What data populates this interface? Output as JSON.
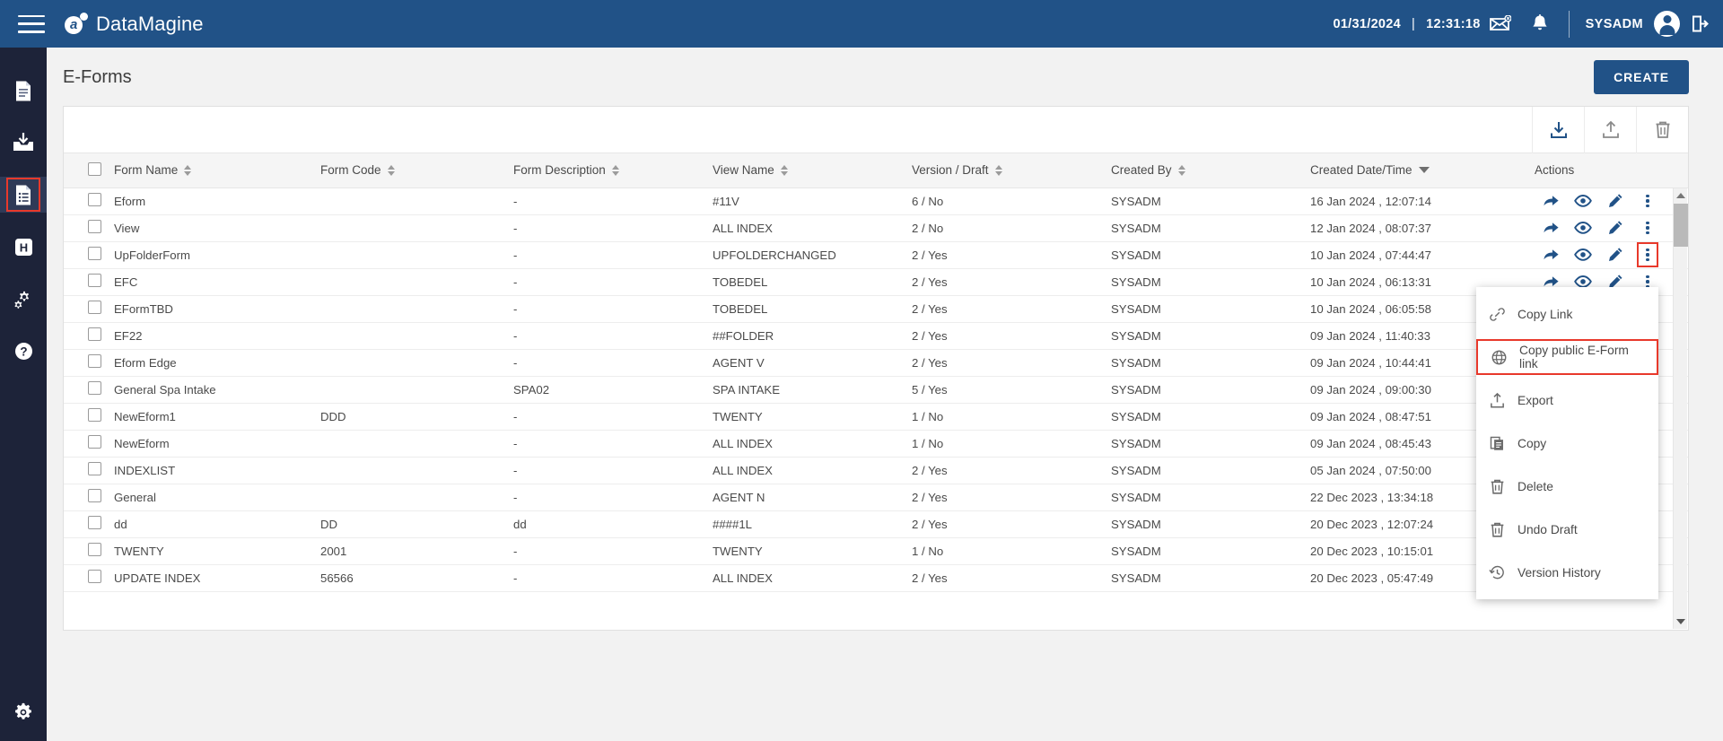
{
  "header": {
    "menu_icon": "hamburger-icon",
    "brand": "DataMagine",
    "date": "01/31/2024",
    "separator": "|",
    "time": "12:31:18",
    "mail_icon": "mail-icon",
    "bell_icon": "bell-icon",
    "username": "SYSADM",
    "avatar_icon": "user-avatar-icon",
    "logout_icon": "logout-icon"
  },
  "sidebar": {
    "items": [
      {
        "name": "document-icon",
        "label": "Documents",
        "active": false
      },
      {
        "name": "inbox-download-icon",
        "label": "Import",
        "active": false
      },
      {
        "name": "eform-document-icon",
        "label": "E-Forms",
        "active": true
      },
      {
        "name": "h-badge-icon",
        "label": "History",
        "active": false
      },
      {
        "name": "gears-icon",
        "label": "Workflow",
        "active": false
      },
      {
        "name": "help-circle-icon",
        "label": "Help",
        "active": false
      }
    ],
    "settings": {
      "name": "settings-gear-icon",
      "label": "Settings"
    }
  },
  "page": {
    "title": "E-Forms",
    "create_button": "CREATE"
  },
  "toolbar": {
    "buttons": [
      {
        "name": "download-icon",
        "label": "Download",
        "color": "#215287"
      },
      {
        "name": "upload-icon",
        "label": "Upload",
        "color": "#8a8a8a"
      },
      {
        "name": "trash-icon",
        "label": "Delete",
        "color": "#8a8a8a"
      }
    ]
  },
  "table": {
    "columns": [
      {
        "key": "checkbox",
        "label": "",
        "sortable": false
      },
      {
        "key": "form_name",
        "label": "Form Name",
        "sortable": true,
        "sorted": "none"
      },
      {
        "key": "form_code",
        "label": "Form Code",
        "sortable": true,
        "sorted": "none"
      },
      {
        "key": "form_description",
        "label": "Form Description",
        "sortable": true,
        "sorted": "none"
      },
      {
        "key": "view_name",
        "label": "View Name",
        "sortable": true,
        "sorted": "none"
      },
      {
        "key": "version_draft",
        "label": "Version / Draft",
        "sortable": true,
        "sorted": "none"
      },
      {
        "key": "created_by",
        "label": "Created By",
        "sortable": true,
        "sorted": "none"
      },
      {
        "key": "created_date_time",
        "label": "Created Date/Time",
        "sortable": true,
        "sorted": "desc"
      },
      {
        "key": "actions",
        "label": "Actions",
        "sortable": false
      }
    ],
    "rows": [
      {
        "form_name": "Eform",
        "form_code": "",
        "form_description": "-",
        "view_name": "#11V",
        "version_draft": "6 / No",
        "created_by": "SYSADM",
        "created_date_time": "16 Jan 2024 , 12:07:14",
        "menu_open": false
      },
      {
        "form_name": "View",
        "form_code": "",
        "form_description": "-",
        "view_name": "ALL INDEX",
        "version_draft": "2 / No",
        "created_by": "SYSADM",
        "created_date_time": "12 Jan 2024 , 08:07:37",
        "menu_open": false
      },
      {
        "form_name": "UpFolderForm",
        "form_code": "",
        "form_description": "-",
        "view_name": "UPFOLDERCHANGED",
        "version_draft": "2 / Yes",
        "created_by": "SYSADM",
        "created_date_time": "10 Jan 2024 , 07:44:47",
        "menu_open": true
      },
      {
        "form_name": "EFC",
        "form_code": "",
        "form_description": "-",
        "view_name": "TOBEDEL",
        "version_draft": "2 / Yes",
        "created_by": "SYSADM",
        "created_date_time": "10 Jan 2024 , 06:13:31",
        "menu_open": false
      },
      {
        "form_name": "EFormTBD",
        "form_code": "",
        "form_description": "-",
        "view_name": "TOBEDEL",
        "version_draft": "2 / Yes",
        "created_by": "SYSADM",
        "created_date_time": "10 Jan 2024 , 06:05:58",
        "menu_open": false
      },
      {
        "form_name": "EF22",
        "form_code": "",
        "form_description": "-",
        "view_name": "##FOLDER",
        "version_draft": "2 / Yes",
        "created_by": "SYSADM",
        "created_date_time": "09 Jan 2024 , 11:40:33",
        "menu_open": false
      },
      {
        "form_name": "Eform Edge",
        "form_code": "",
        "form_description": "-",
        "view_name": "AGENT V",
        "version_draft": "2 / Yes",
        "created_by": "SYSADM",
        "created_date_time": "09 Jan 2024 , 10:44:41",
        "menu_open": false
      },
      {
        "form_name": "General Spa Intake",
        "form_code": "",
        "form_description": "SPA02",
        "view_name": "SPA INTAKE",
        "version_draft": "5 / Yes",
        "created_by": "SYSADM",
        "created_date_time": "09 Jan 2024 , 09:00:30",
        "menu_open": false
      },
      {
        "form_name": "NewEform1",
        "form_code": "DDD",
        "form_description": "-",
        "view_name": "TWENTY",
        "version_draft": "1 / No",
        "created_by": "SYSADM",
        "created_date_time": "09 Jan 2024 , 08:47:51",
        "menu_open": false
      },
      {
        "form_name": "NewEform",
        "form_code": "",
        "form_description": "-",
        "view_name": "ALL INDEX",
        "version_draft": "1 / No",
        "created_by": "SYSADM",
        "created_date_time": "09 Jan 2024 , 08:45:43",
        "menu_open": false
      },
      {
        "form_name": "INDEXLIST",
        "form_code": "",
        "form_description": "-",
        "view_name": "ALL INDEX",
        "version_draft": "2 / Yes",
        "created_by": "SYSADM",
        "created_date_time": "05 Jan 2024 , 07:50:00",
        "menu_open": false
      },
      {
        "form_name": "General",
        "form_code": "",
        "form_description": "-",
        "view_name": "AGENT N",
        "version_draft": "2 / Yes",
        "created_by": "SYSADM",
        "created_date_time": "22 Dec 2023 , 13:34:18",
        "menu_open": false
      },
      {
        "form_name": "dd",
        "form_code": "DD",
        "form_description": "dd",
        "view_name": "####1L",
        "version_draft": "2 / Yes",
        "created_by": "SYSADM",
        "created_date_time": "20 Dec 2023 , 12:07:24",
        "menu_open": false
      },
      {
        "form_name": "TWENTY",
        "form_code": "2001",
        "form_description": "-",
        "view_name": "TWENTY",
        "version_draft": "1 / No",
        "created_by": "SYSADM",
        "created_date_time": "20 Dec 2023 , 10:15:01",
        "menu_open": false
      },
      {
        "form_name": "UPDATE INDEX",
        "form_code": "56566",
        "form_description": "-",
        "view_name": "ALL INDEX",
        "version_draft": "2 / Yes",
        "created_by": "SYSADM",
        "created_date_time": "20 Dec 2023 , 05:47:49",
        "menu_open": false
      }
    ],
    "row_actions": [
      {
        "name": "share-icon",
        "label": "Share"
      },
      {
        "name": "eye-icon",
        "label": "View"
      },
      {
        "name": "pencil-icon",
        "label": "Edit"
      },
      {
        "name": "kebab-menu-icon",
        "label": "More"
      }
    ]
  },
  "context_menu": {
    "items": [
      {
        "label": "Copy Link",
        "icon": "link-icon",
        "highlighted": false
      },
      {
        "label": "Copy public E-Form link",
        "icon": "globe-icon",
        "highlighted": true
      },
      {
        "label": "Export",
        "icon": "export-icon",
        "highlighted": false
      },
      {
        "label": "Copy",
        "icon": "copy-icon",
        "highlighted": false
      },
      {
        "label": "Delete",
        "icon": "trash-icon",
        "highlighted": false
      },
      {
        "label": "Undo Draft",
        "icon": "trash-icon",
        "highlighted": false
      },
      {
        "label": "Version History",
        "icon": "history-icon",
        "highlighted": false
      }
    ]
  },
  "colors": {
    "brand_blue": "#215287",
    "rail_dark": "#1d2339",
    "highlight_red": "#e8392b",
    "page_bg": "#f2f2f2"
  }
}
